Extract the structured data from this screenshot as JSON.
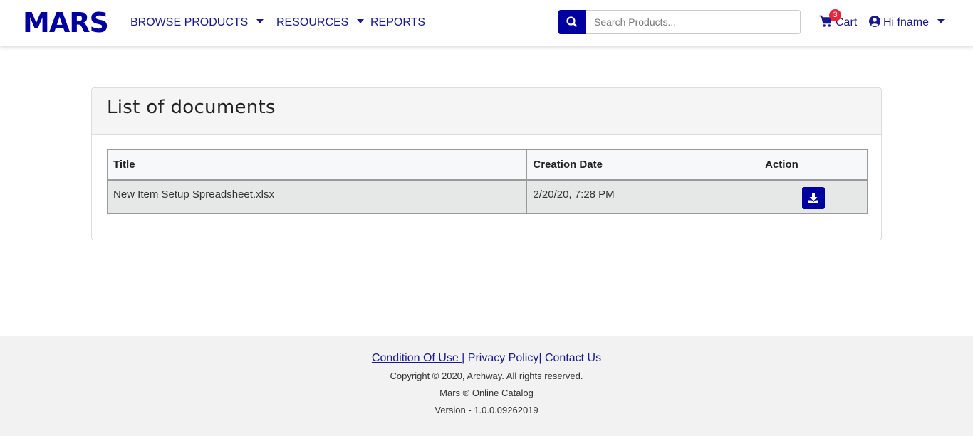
{
  "header": {
    "logo": "MARS",
    "nav": {
      "browse": "BROWSE PRODUCTS",
      "resources": "RESOURCES",
      "reports": "REPORTS"
    },
    "search_placeholder": "Search Products...",
    "cart": {
      "label": "Cart",
      "count": "3"
    },
    "user": "Hi fname"
  },
  "card": {
    "title": "List of documents",
    "columns": {
      "title": "Title",
      "date": "Creation Date",
      "action": "Action"
    },
    "rows": [
      {
        "title": "New Item Setup Spreadsheet.xlsx",
        "date": "2/20/20, 7:28 PM"
      }
    ]
  },
  "footer": {
    "condition": "Condition Of Use ",
    "sep1": "|",
    "privacy": " Privacy Policy",
    "sep2": "|",
    "contact": " Contact Us",
    "copyright": "Copyright © 2020, Archway. All rights reserved.",
    "catalog": "Mars ® Online Catalog",
    "version": "Version - 1.0.0.09262019"
  },
  "colors": {
    "brand": "#0000a0",
    "nav_text": "#1a1a8c",
    "badge": "#e8253b"
  },
  "icons": [
    "search-icon",
    "cart-icon",
    "user-circle-icon",
    "chevron-down-icon",
    "download-icon"
  ]
}
